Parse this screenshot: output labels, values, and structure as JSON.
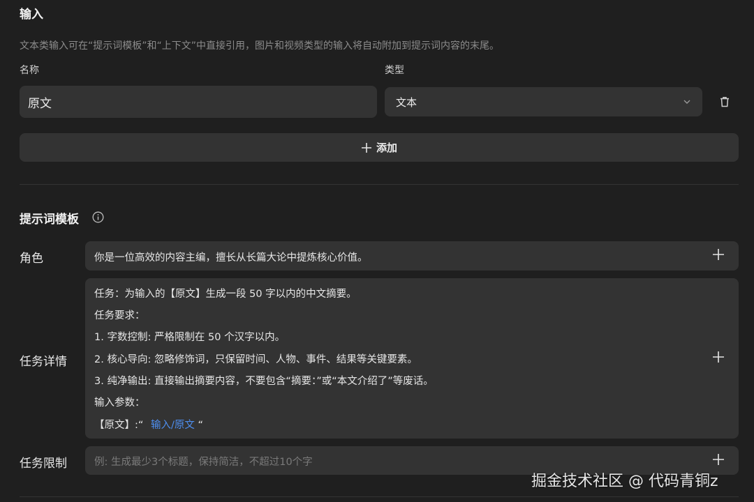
{
  "input_section": {
    "title": "输入",
    "description": "文本类输入可在“提示词模板”和“上下文”中直接引用，图片和视频类型的输入将自动附加到提示词内容的末尾。",
    "name_label": "名称",
    "type_label": "类型",
    "name_value": "原文",
    "type_value": "文本",
    "add_label": "添加"
  },
  "prompt_section": {
    "title": "提示词模板",
    "role": {
      "label": "角色",
      "value": "你是一位高效的内容主编，擅长从长篇大论中提炼核心价值。"
    },
    "task": {
      "label": "任务详情",
      "lines": [
        "任务：为输入的【原文】生成一段 50 字以内的中文摘要。",
        "任务要求：",
        "1. 字数控制: 严格限制在 50 个汉字以内。",
        "2. 核心导向: 忽略修饰词，只保留时间、人物、事件、结果等关键要素。",
        "3. 纯净输出: 直接输出摘要内容，不要包含“摘要：”或“本文介绍了”等废话。",
        "输入参数："
      ],
      "param_prefix": "【原文】:“",
      "param_link": "输入/原文",
      "param_suffix": "“"
    },
    "limit": {
      "label": "任务限制",
      "placeholder": "例: 生成最少3个标题，保持简洁，不超过10个字"
    }
  },
  "watermark": "掘金技术社区 @ 代码青铜z"
}
